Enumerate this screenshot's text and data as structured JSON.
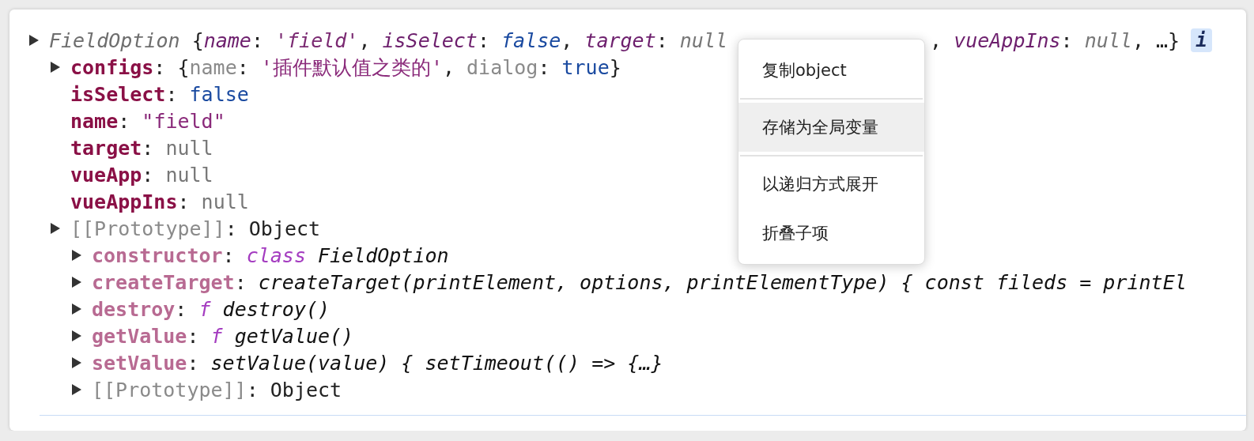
{
  "tree": [
    {
      "toggle": true,
      "tokens": [
        {
          "kind": "class",
          "text": "FieldOption"
        },
        {
          "kind": "punct",
          "text": " {"
        },
        {
          "kind": "skey",
          "text": "name"
        },
        {
          "kind": "punct",
          "text": ": "
        },
        {
          "kind": "sstring",
          "text": "'field'"
        },
        {
          "kind": "punct",
          "text": ", "
        },
        {
          "kind": "skey",
          "text": "isSelect"
        },
        {
          "kind": "punct",
          "text": ": "
        },
        {
          "kind": "sbool",
          "text": "false"
        },
        {
          "kind": "punct",
          "text": ", "
        },
        {
          "kind": "skey",
          "text": "target"
        },
        {
          "kind": "punct",
          "text": ": "
        },
        {
          "kind": "snull",
          "text": "null"
        }
      ],
      "tail_tokens": [
        {
          "kind": "punct",
          "text": ", "
        },
        {
          "kind": "skey",
          "text": "vueAppIns"
        },
        {
          "kind": "punct",
          "text": ": "
        },
        {
          "kind": "snull",
          "text": "null"
        },
        {
          "kind": "punct",
          "text": ", …}"
        }
      ],
      "badge": "i",
      "children": [
        {
          "toggle": true,
          "tokens": [
            {
              "kind": "key",
              "text": "configs"
            },
            {
              "kind": "punct",
              "text": ": {"
            },
            {
              "kind": "dim",
              "text": "name"
            },
            {
              "kind": "punct",
              "text": ": "
            },
            {
              "kind": "string",
              "text": "'插件默认值之类的'"
            },
            {
              "kind": "punct",
              "text": ", "
            },
            {
              "kind": "dim",
              "text": "dialog"
            },
            {
              "kind": "punct",
              "text": ": "
            },
            {
              "kind": "bool",
              "text": "true"
            },
            {
              "kind": "punct",
              "text": "}"
            }
          ]
        },
        {
          "toggle": false,
          "tokens": [
            {
              "kind": "key",
              "text": "isSelect"
            },
            {
              "kind": "punct",
              "text": ": "
            },
            {
              "kind": "bool",
              "text": "false"
            }
          ]
        },
        {
          "toggle": false,
          "tokens": [
            {
              "kind": "key",
              "text": "name"
            },
            {
              "kind": "punct",
              "text": ": "
            },
            {
              "kind": "string",
              "text": "\"field\""
            }
          ]
        },
        {
          "toggle": false,
          "tokens": [
            {
              "kind": "key",
              "text": "target"
            },
            {
              "kind": "punct",
              "text": ": "
            },
            {
              "kind": "null",
              "text": "null"
            }
          ]
        },
        {
          "toggle": false,
          "tokens": [
            {
              "kind": "key",
              "text": "vueApp"
            },
            {
              "kind": "punct",
              "text": ": "
            },
            {
              "kind": "null",
              "text": "null"
            }
          ]
        },
        {
          "toggle": false,
          "tokens": [
            {
              "kind": "key",
              "text": "vueAppIns"
            },
            {
              "kind": "punct",
              "text": ": "
            },
            {
              "kind": "null",
              "text": "null"
            }
          ]
        },
        {
          "toggle": true,
          "tokens": [
            {
              "kind": "dim",
              "text": "[[Prototype]]"
            },
            {
              "kind": "punct",
              "text": ": Object"
            }
          ],
          "children": [
            {
              "toggle": true,
              "tokens": [
                {
                  "kind": "ikey",
                  "text": "constructor"
                },
                {
                  "kind": "punct",
                  "text": ": "
                },
                {
                  "kind": "keyword",
                  "text": "class"
                },
                {
                  "kind": "italic",
                  "text": " FieldOption"
                }
              ]
            },
            {
              "toggle": true,
              "tokens": [
                {
                  "kind": "ikey",
                  "text": "createTarget"
                },
                {
                  "kind": "punct",
                  "text": ": "
                },
                {
                  "kind": "italic",
                  "text": "createTarget(printElement, options, printElementType) { const fileds = printEl"
                }
              ]
            },
            {
              "toggle": true,
              "tokens": [
                {
                  "kind": "ikey",
                  "text": "destroy"
                },
                {
                  "kind": "punct",
                  "text": ": "
                },
                {
                  "kind": "keyword",
                  "text": "f"
                },
                {
                  "kind": "italic",
                  "text": " destroy()"
                }
              ]
            },
            {
              "toggle": true,
              "tokens": [
                {
                  "kind": "ikey",
                  "text": "getValue"
                },
                {
                  "kind": "punct",
                  "text": ": "
                },
                {
                  "kind": "keyword",
                  "text": "f"
                },
                {
                  "kind": "italic",
                  "text": " getValue()"
                }
              ]
            },
            {
              "toggle": true,
              "tokens": [
                {
                  "kind": "ikey",
                  "text": "setValue"
                },
                {
                  "kind": "punct",
                  "text": ": "
                },
                {
                  "kind": "italic",
                  "text": "setValue(value) { setTimeout(() => {…}"
                }
              ]
            },
            {
              "toggle": true,
              "tokens": [
                {
                  "kind": "dim",
                  "text": "[[Prototype]]"
                },
                {
                  "kind": "punct",
                  "text": ": Object"
                }
              ]
            }
          ]
        }
      ]
    }
  ],
  "context_menu": [
    {
      "label": "复制object",
      "selected": false,
      "divider_after": true
    },
    {
      "label": "存储为全局变量",
      "selected": true,
      "divider_after": true
    },
    {
      "label": "以递归方式展开",
      "selected": false,
      "divider_after": false
    },
    {
      "label": "折叠子项",
      "selected": false,
      "divider_after": false
    }
  ]
}
